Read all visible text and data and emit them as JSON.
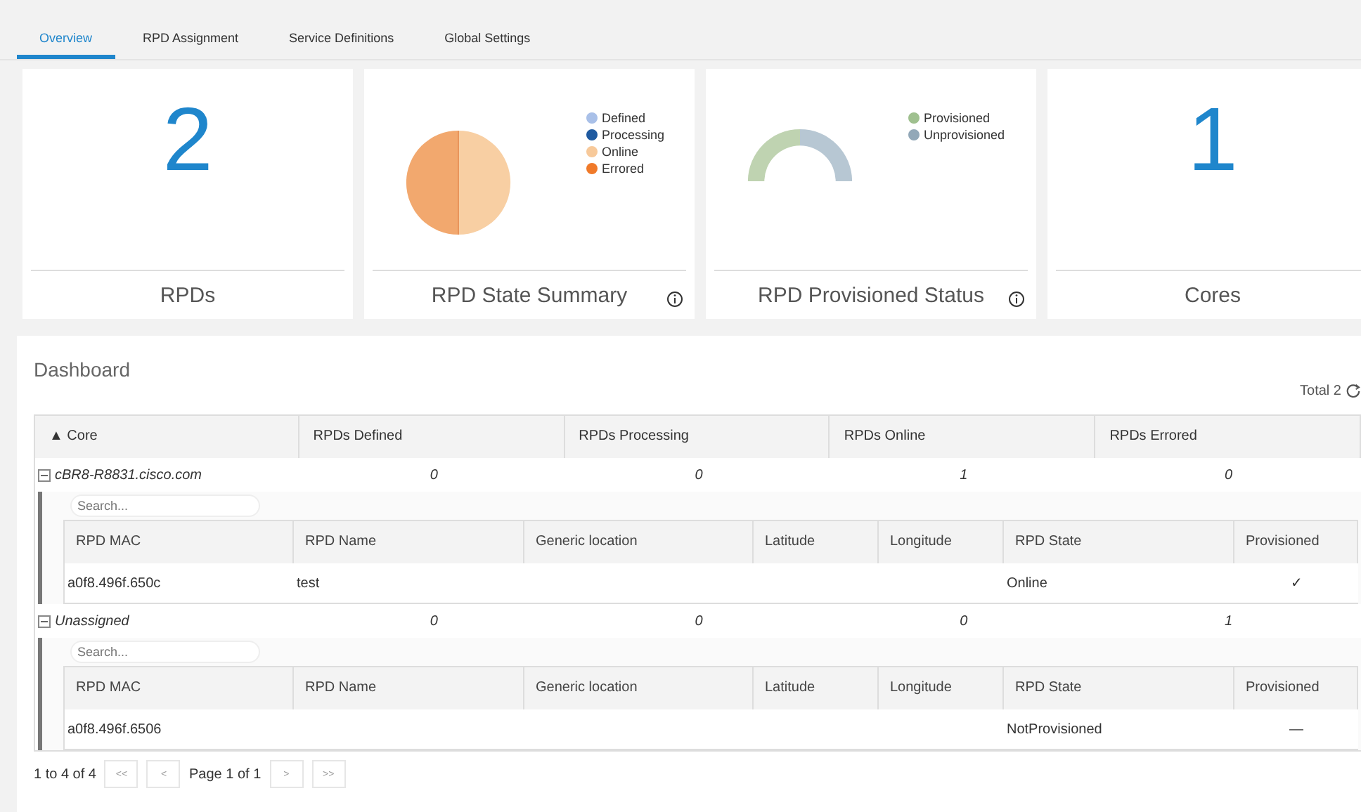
{
  "tabs": [
    {
      "label": "Overview",
      "selected": true
    },
    {
      "label": "RPD Assignment",
      "selected": false
    },
    {
      "label": "Service Definitions",
      "selected": false
    },
    {
      "label": "Global Settings",
      "selected": false
    }
  ],
  "cards": [
    {
      "kind": "number",
      "value": "2",
      "title": "RPDs"
    },
    {
      "kind": "pie",
      "title": "RPD State Summary",
      "info": true,
      "legend": [
        {
          "label": "Defined",
          "color": "#a9c0e8"
        },
        {
          "label": "Processing",
          "color": "#1f5aa0"
        },
        {
          "label": "Online",
          "color": "#f7c99a"
        },
        {
          "label": "Errored",
          "color": "#f07a2a"
        }
      ]
    },
    {
      "kind": "gauge",
      "title": "RPD Provisioned Status",
      "info": true,
      "legend": [
        {
          "label": "Provisioned",
          "color": "#9fc08f"
        },
        {
          "label": "Unprovisioned",
          "color": "#92a8b8"
        }
      ]
    },
    {
      "kind": "number",
      "value": "1",
      "title": "Cores"
    }
  ],
  "dashboard": {
    "title": "Dashboard",
    "total": "Total 2",
    "columns": [
      "▲ Core",
      "RPDs Defined",
      "RPDs Processing",
      "RPDs Online",
      "RPDs Errored"
    ],
    "groups": [
      {
        "core": "cBR8-R8831.cisco.com",
        "expanded": true,
        "counts": [
          "0",
          "0",
          "1",
          "0"
        ],
        "search_placeholder": "Search...",
        "columns": [
          "RPD MAC",
          "RPD Name",
          "Generic location",
          "Latitude",
          "Longitude",
          "RPD State",
          "Provisioned"
        ],
        "rows": [
          [
            "a0f8.496f.650c",
            "test",
            "",
            "",
            "",
            "Online",
            "✓"
          ]
        ]
      },
      {
        "core": "Unassigned",
        "expanded": true,
        "counts": [
          "0",
          "0",
          "0",
          "1"
        ],
        "search_placeholder": "Search...",
        "columns": [
          "RPD MAC",
          "RPD Name",
          "Generic location",
          "Latitude",
          "Longitude",
          "RPD State",
          "Provisioned"
        ],
        "rows": [
          [
            "a0f8.496f.6506",
            "",
            "",
            "",
            "",
            "NotProvisioned",
            "—"
          ]
        ]
      }
    ],
    "pager": {
      "range": "1 to 4 of 4",
      "first": "<<",
      "prev": "<",
      "page": "Page 1 of 1",
      "next": ">",
      "last": ">>"
    }
  }
}
